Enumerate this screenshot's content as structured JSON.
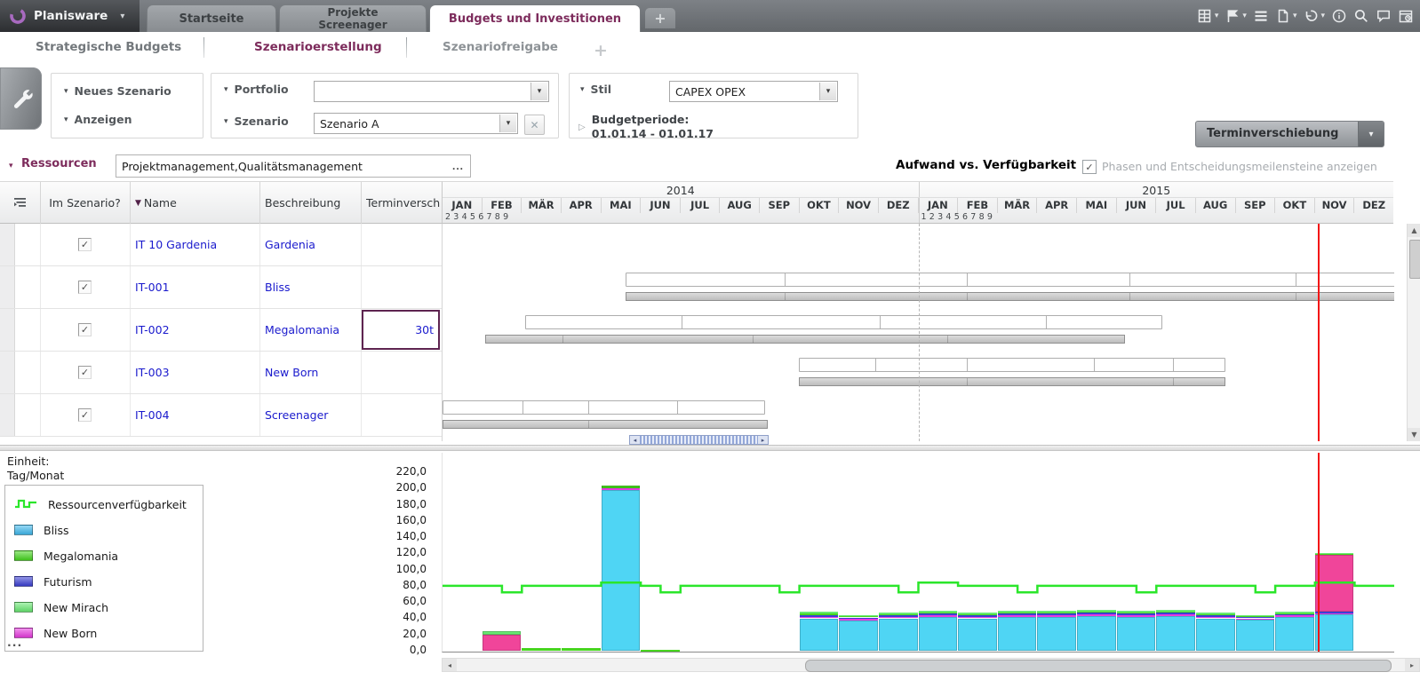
{
  "glyphs": {
    "caret_down": "▾",
    "sort_down": "▼",
    "caret_right": "▷",
    "plus": "+",
    "close": "✕",
    "ellipsis": "...",
    "check": "✓",
    "arrow_left": "◂",
    "arrow_right": "▸",
    "arrow_up": "▲",
    "arrow_down": "▼"
  },
  "top_bar": {
    "brand": "Planisware",
    "tabs": [
      {
        "label": "Startseite"
      },
      {
        "label": "Projekte",
        "sublabel": "Screenager"
      },
      {
        "label": "Budgets und Investitionen"
      }
    ],
    "toolbar_icons": [
      "export-excel-icon",
      "flag-icon",
      "list-icon",
      "new-document-icon",
      "undo-icon",
      "info-icon",
      "zoom-icon",
      "feedback-icon",
      "time-machine-icon"
    ]
  },
  "subtabs": [
    "Strategische Budgets",
    "Szenarioerstellung",
    "Szenariofreigabe"
  ],
  "controls": {
    "neues_szenario": "Neues Szenario",
    "anzeigen": "Anzeigen",
    "portfolio_label": "Portfolio",
    "portfolio_value": "",
    "szenario_label": "Szenario",
    "szenario_value": "Szenario A",
    "stil_label": "Stil",
    "stil_value": "CAPEX OPEX",
    "budgetperiode_label": "Budgetperiode:",
    "budgetperiode_value": "01.01.14 - 01.01.17",
    "terminverschiebung": "Terminverschiebung"
  },
  "resources": {
    "label": "Ressourcen",
    "value": "Projektmanagement,Qualitätsmanagement",
    "chart_title": "Aufwand vs. Verfügbarkeit",
    "phases_label": "Phasen und Entscheidungsmeilensteine anzeigen",
    "phases_checked": true
  },
  "table": {
    "columns": [
      "Im Szenario?",
      "Name",
      "Beschreibung",
      "Terminverschiebung"
    ],
    "rows": [
      {
        "checked": true,
        "name": "IT 10 Gardenia",
        "description": "Gardenia",
        "shift": ""
      },
      {
        "checked": true,
        "name": "IT-001",
        "description": "Bliss",
        "shift": ""
      },
      {
        "checked": true,
        "name": "IT-002",
        "description": "Megalomania",
        "shift": "30t",
        "selected": true
      },
      {
        "checked": true,
        "name": "IT-003",
        "description": "New Born",
        "shift": ""
      },
      {
        "checked": true,
        "name": "IT-004",
        "description": "Screenager",
        "shift": ""
      }
    ]
  },
  "timeline": {
    "years": [
      "2014",
      "2015"
    ],
    "months": [
      "JAN",
      "FEB",
      "MÄR",
      "APR",
      "MAI",
      "JUN",
      "JUL",
      "AUG",
      "SEP",
      "OKT",
      "NOV",
      "DEZ"
    ],
    "sub_2014": [
      "2",
      "3",
      "4",
      "5",
      "6",
      "7",
      "8",
      "9"
    ],
    "sub_2015": [
      "1",
      "2",
      "3",
      "4",
      "5",
      "6",
      "7",
      "8",
      "9"
    ]
  },
  "gantt": {
    "rows": [
      {
        "row": 1,
        "name": "Bliss",
        "color": "#3aa8ec",
        "bar": {
          "start": 4.62,
          "end": 24.05,
          "dividers": [
            8.6,
            13.2,
            17.3,
            21.5
          ]
        },
        "baseline": {
          "start": 4.62,
          "end": 24.05,
          "dividers": [
            8.6,
            13.2,
            17.3,
            21.5
          ]
        }
      },
      {
        "row": 2,
        "name": "Megalomania",
        "color": "#5cd52c",
        "bar": {
          "start": 2.08,
          "end": 18.15,
          "dividers": [
            6.0,
            11.0,
            15.2
          ]
        },
        "baseline": {
          "start": 1.08,
          "end": 17.2,
          "dividers": [
            3.0,
            7.8,
            12.7
          ]
        }
      },
      {
        "row": 3,
        "name": "New Born",
        "color": "#e13ce1",
        "bar": {
          "start": 8.98,
          "end": 19.74,
          "dividers": [
            10.9,
            13.2,
            16.4,
            18.4
          ]
        },
        "baseline": {
          "start": 8.98,
          "end": 19.74,
          "dividers": [
            13.2,
            18.4
          ]
        }
      },
      {
        "row": 4,
        "name": "Screenager",
        "color": "#ef3a99",
        "bar": {
          "start": 0,
          "end": 8.13,
          "dividers": [
            2.0,
            3.65,
            5.9
          ]
        },
        "baseline": {
          "start": 0,
          "end": 8.2,
          "dividers": [
            3.65
          ]
        }
      }
    ],
    "markers": {
      "today_month": 22.07,
      "year_divider_month": 12
    }
  },
  "legend": {
    "unit_label": "Einheit:",
    "unit_value": "Tag/Monat",
    "items": [
      {
        "label": "Ressourcenverfügbarkeit",
        "type": "line",
        "color": "#2be62b"
      },
      {
        "label": "Bliss",
        "type": "box",
        "color": "#3fb9ee"
      },
      {
        "label": "Megalomania",
        "type": "box",
        "color": "#46d51e"
      },
      {
        "label": "Futurism",
        "type": "box",
        "color": "#3b3fd4"
      },
      {
        "label": "New Mirach",
        "type": "box",
        "color": "#68e972"
      },
      {
        "label": "New Born",
        "type": "box",
        "color": "#e83ae0"
      }
    ],
    "more": "..."
  },
  "chart_data": {
    "type": "bar",
    "subtype": "stacked-bars-with-step-line",
    "title": "Aufwand vs. Verfügbarkeit",
    "unit": "Tag/Monat",
    "x": {
      "years": [
        "2014",
        "2015"
      ],
      "months_per_year": [
        "JAN",
        "FEB",
        "MÄR",
        "APR",
        "MAI",
        "JUN",
        "JUL",
        "AUG",
        "SEP",
        "OKT",
        "NOV",
        "DEZ"
      ]
    },
    "ylim": [
      0,
      220
    ],
    "ytick_step": 20,
    "yticks": [
      "220,0",
      "200,0",
      "180,0",
      "160,0",
      "140,0",
      "120,0",
      "100,0",
      "80,0",
      "60,0",
      "40,0",
      "20,0",
      "0,0"
    ],
    "stack_order": "bottom-to-top",
    "series": [
      {
        "name": "Bliss",
        "color": "#4fd5f4",
        "values": [
          0,
          0,
          0,
          0,
          198,
          0,
          0,
          0,
          0,
          40,
          37,
          40,
          42,
          40,
          42,
          42,
          43,
          42,
          43,
          40,
          38,
          42,
          45,
          0
        ]
      },
      {
        "name": "New Born",
        "color": "#e83ae0",
        "values": [
          0,
          0,
          0,
          0,
          2,
          0,
          0,
          0,
          0,
          2,
          2,
          2,
          2,
          2,
          2,
          2,
          2,
          2,
          2,
          2,
          2,
          2,
          2,
          0
        ]
      },
      {
        "name": "Futurism",
        "color": "#3b3fd4",
        "values": [
          0,
          0,
          0,
          0,
          0,
          0,
          0,
          0,
          0,
          2,
          2,
          2,
          2,
          2,
          2,
          2,
          2,
          2,
          2,
          2,
          2,
          2,
          1,
          0
        ]
      },
      {
        "name": "Screenager",
        "color": "#f0459a",
        "values": [
          0,
          20,
          0,
          0,
          0,
          0,
          0,
          0,
          0,
          0,
          0,
          0,
          0,
          0,
          0,
          0,
          0,
          0,
          0,
          0,
          0,
          0,
          70,
          0
        ]
      },
      {
        "name": "Megalomania",
        "color": "#46d51e",
        "values": [
          0,
          0,
          3,
          3,
          4,
          1,
          0,
          0,
          0,
          3,
          2,
          2,
          2,
          2,
          2,
          2,
          2,
          2,
          2,
          2,
          1,
          1,
          2,
          0
        ]
      },
      {
        "name": "New Mirach",
        "color": "#68e972",
        "values": [
          0,
          4,
          0,
          0,
          0,
          0,
          0,
          0,
          0,
          1,
          1,
          1,
          1,
          1,
          1,
          1,
          1,
          1,
          1,
          1,
          1,
          1,
          1,
          0
        ]
      }
    ],
    "availability": {
      "name": "Ressourcenverfügbarkeit",
      "color": "#2be62b",
      "halfmonth_values": [
        80,
        80,
        80,
        72,
        80,
        80,
        80,
        80,
        84,
        84,
        80,
        72,
        80,
        80,
        80,
        80,
        80,
        72,
        80,
        80,
        80,
        80,
        80,
        72,
        84,
        84,
        80,
        80,
        80,
        72,
        80,
        80,
        80,
        80,
        80,
        72,
        80,
        80,
        80,
        80,
        80,
        72,
        80,
        80,
        84,
        84,
        80,
        80
      ]
    },
    "markers": {
      "today_line_month": 22.07,
      "today_line_color": "#f31414"
    }
  }
}
